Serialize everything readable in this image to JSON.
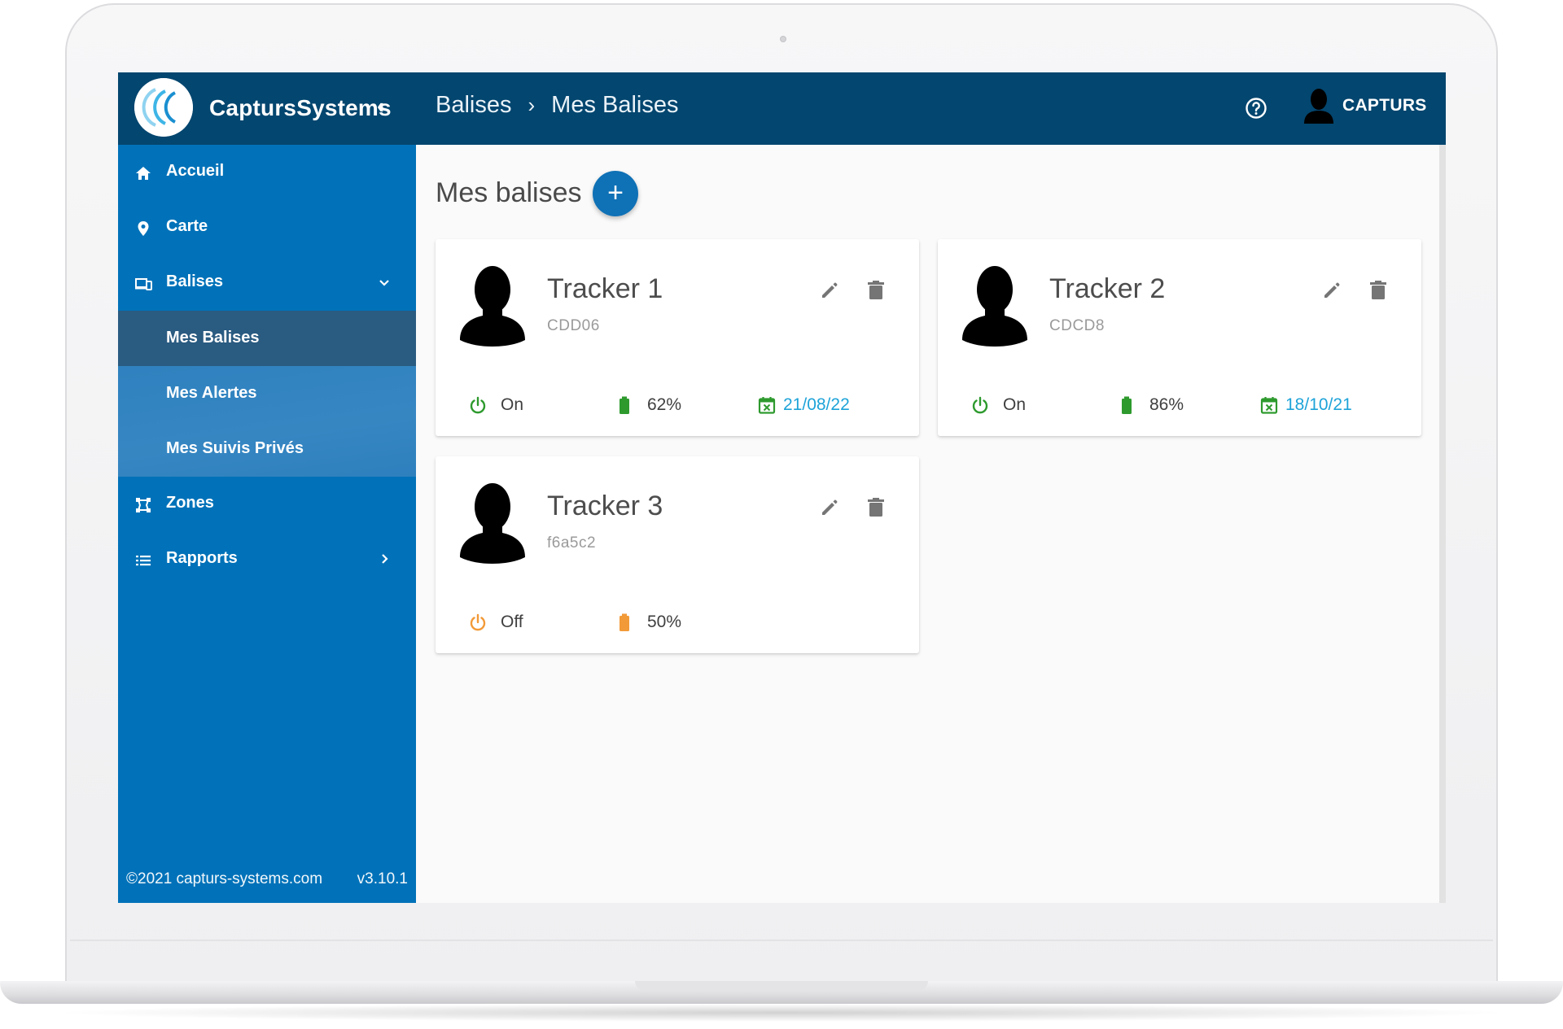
{
  "app": {
    "brand": "CaptursSystems",
    "collapse_glyph": "‹"
  },
  "header": {
    "breadcrumb": [
      "Balises",
      "Mes Balises"
    ],
    "breadcrumb_sep": "›",
    "user": "CAPTURS"
  },
  "sidebar": {
    "items": [
      {
        "label": "Accueil",
        "icon": "home-icon"
      },
      {
        "label": "Carte",
        "icon": "map-pin-icon"
      },
      {
        "label": "Balises",
        "icon": "devices-icon",
        "expanded": true
      },
      {
        "label": "Zones",
        "icon": "zones-icon"
      },
      {
        "label": "Rapports",
        "icon": "list-icon"
      }
    ],
    "sub_items": [
      {
        "label": "Mes Balises",
        "active": true
      },
      {
        "label": "Mes Alertes"
      },
      {
        "label": "Mes Suivis Privés"
      }
    ],
    "footer_copyright": "©2021 capturs-systems.com",
    "footer_version": "v3.10.1"
  },
  "main": {
    "title": "Mes balises",
    "add_glyph": "+",
    "trackers": [
      {
        "name": "Tracker 1",
        "code": "CDD06",
        "power": "On",
        "battery": "62%",
        "date": "21/08/22"
      },
      {
        "name": "Tracker 2",
        "code": "CDCD8",
        "power": "On",
        "battery": "86%",
        "date": "18/10/21"
      },
      {
        "name": "Tracker 3",
        "code": "f6a5c2",
        "power": "Off",
        "battery": "50%"
      }
    ]
  },
  "colors": {
    "header_bg": "#03466f",
    "sidebar_bg": "#0172b9",
    "active_item_bg": "#2a5b81",
    "accent": "#0f71b6",
    "status_ok": "#2e9a2e",
    "status_warn": "#f29a38",
    "date_text": "#1ea3d8"
  }
}
